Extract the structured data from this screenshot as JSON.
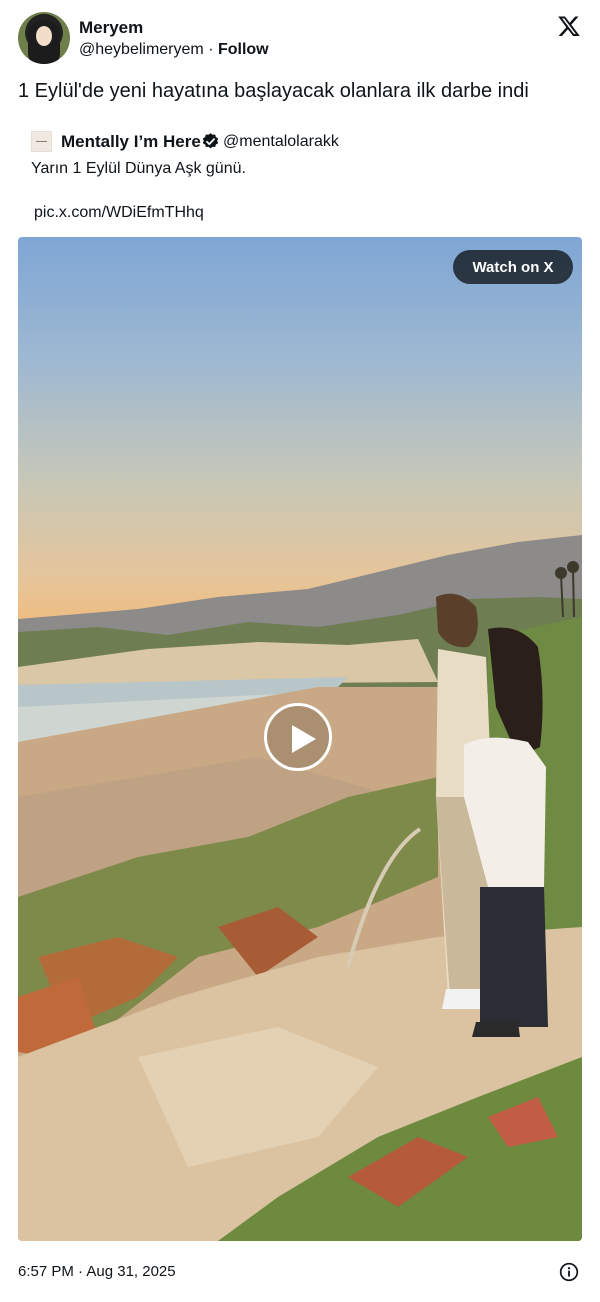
{
  "author": {
    "name": "Meryem",
    "handle": "@heybelimeryem",
    "separator": "·",
    "follow_label": "Follow",
    "avatar_icon": "profile-avatar"
  },
  "platform_icon": "x-logo-icon",
  "tweet": {
    "text": "1 Eylül'de yeni hayatına başlayacak olanlara ilk darbe indi"
  },
  "quoted": {
    "name": "Mentally I’m Here",
    "verified_icon": "verified-badge-icon",
    "handle": "@mentalolarakk",
    "text": "Yarın 1 Eylül Dünya Aşk günü.",
    "link": "pic.x.com/WDiEfmTHhq"
  },
  "media": {
    "type": "video",
    "watch_label": "Watch on X",
    "play_icon": "play-icon"
  },
  "footer": {
    "timestamp": "6:57 PM · Aug 31, 2025",
    "info_icon": "info-icon"
  },
  "colors": {
    "text": "#0f1419",
    "button_bg": "#0f1419",
    "verified": "#0f1419"
  }
}
